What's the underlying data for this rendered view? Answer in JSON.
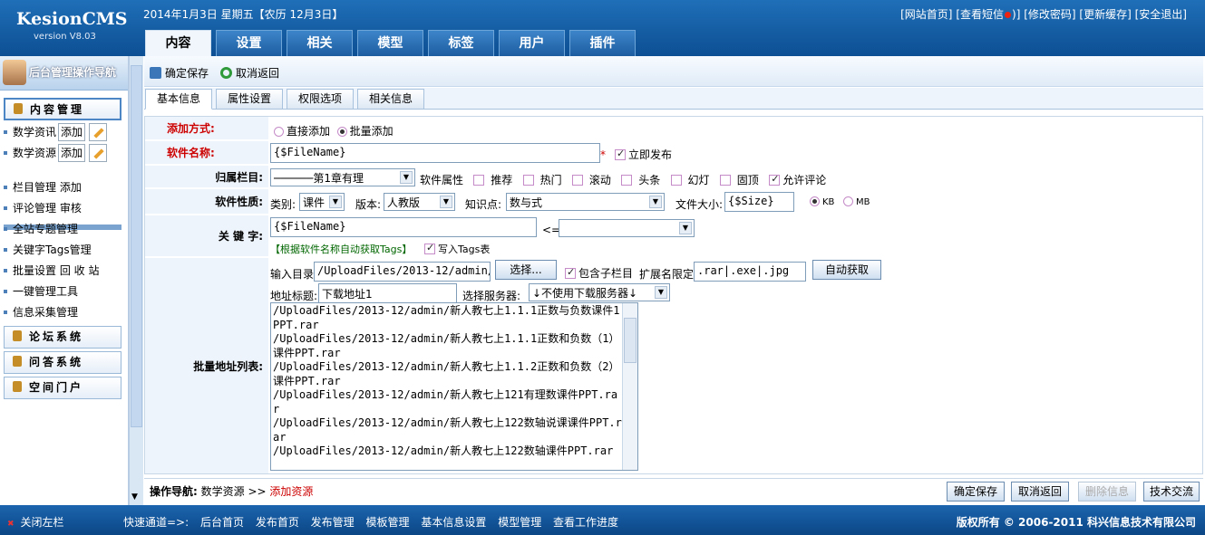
{
  "brand": {
    "name": "KesionCMS",
    "version": "version V8.03"
  },
  "header": {
    "date": "2014年1月3日 星期五",
    "lunar": "【农历 12月3日】",
    "links": [
      "[网站首页]",
      "[查看短信",
      ")]",
      "[修改密码]",
      "[更新缓存]",
      "[安全退出]"
    ]
  },
  "tabs": [
    "内容",
    "设置",
    "相关",
    "模型",
    "标签",
    "用户",
    "插件"
  ],
  "sidebar": {
    "title": "后台管理操作导航",
    "content_section": "内容管理",
    "sub": [
      {
        "label": "数学资讯",
        "add": "添加"
      },
      {
        "label": "数学资源",
        "add": "添加"
      }
    ],
    "links": [
      "栏目管理 添加",
      "评论管理 审核",
      "全站专题管理",
      "关键字Tags管理",
      "批量设置 回 收 站",
      "一键管理工具",
      "信息采集管理"
    ],
    "sections": [
      "论坛系统",
      "问答系统",
      "空间门户"
    ]
  },
  "toolbar": {
    "save": "确定保存",
    "back": "取消返回"
  },
  "subtabs": [
    "基本信息",
    "属性设置",
    "权限选项",
    "相关信息"
  ],
  "form": {
    "add_mode": {
      "label": "添加方式:",
      "opt1": "直接添加",
      "opt2": "批量添加"
    },
    "name": {
      "label": "软件名称:",
      "value": "{$FileName}",
      "req": "*",
      "publish": "立即发布"
    },
    "category": {
      "label": "归属栏目:",
      "value": "──────第1章有理",
      "attr_label": "软件属性",
      "attrs": [
        "推荐",
        "热门",
        "滚动",
        "头条",
        "幻灯",
        "固顶",
        "允许评论"
      ]
    },
    "nature": {
      "label": "软件性质:",
      "type_label": "类别:",
      "type": "课件",
      "ver_label": "版本:",
      "ver": "人教版",
      "kp_label": "知识点:",
      "kp": "数与式",
      "size_label": "文件大小:",
      "size": "{$Size}",
      "kb": "KB",
      "mb": "MB"
    },
    "keywords": {
      "label": "关 键 字:",
      "value": "{$FileName}",
      "arrow": "<=",
      "auto": "【根据软件名称自动获取Tags】",
      "write": "写入Tags表"
    },
    "batch": {
      "dir_label": "输入目录",
      "dir": "/UploadFiles/2013-12/admin/",
      "choose": "选择...",
      "sub": "包含子栏目",
      "ext_label": "扩展名限定",
      "ext": ".rar|.exe|.jpg",
      "auto": "自动获取",
      "title_label": "地址标题:",
      "title": "下载地址1",
      "server_label": "选择服务器:",
      "server": "↓不使用下载服务器↓",
      "list_label": "批量地址列表:",
      "list": [
        "/UploadFiles/2013-12/admin/新人教七上1.1.1正数与负数课件1PPT.rar",
        "/UploadFiles/2013-12/admin/新人教七上1.1.1正数和负数（1）课件PPT.rar",
        "/UploadFiles/2013-12/admin/新人教七上1.1.2正数和负数（2）课件PPT.rar",
        "/UploadFiles/2013-12/admin/新人教七上121有理数课件PPT.rar",
        "/UploadFiles/2013-12/admin/新人教七上122数轴说课课件PPT.rar",
        "/UploadFiles/2013-12/admin/新人教七上122数轴课件PPT.rar"
      ]
    }
  },
  "bottom": {
    "nav_label": "操作导航:",
    "crumb1": "数学资源",
    "sep": ">>",
    "crumb2": "添加资源",
    "buttons": [
      "确定保存",
      "取消返回",
      "删除信息",
      "技术交流"
    ]
  },
  "footer": {
    "close": "关闭左栏",
    "quick_label": "快速通道=>:",
    "quick": [
      "后台首页",
      "发布首页",
      "发布管理",
      "模板管理",
      "基本信息设置",
      "模型管理",
      "查看工作进度"
    ],
    "copy": "版权所有 © 2006-2011 科兴信息技术有限公司"
  },
  "colors": {
    "header": "#1561a8",
    "required": "#cc0000",
    "link_green": "#006600"
  }
}
